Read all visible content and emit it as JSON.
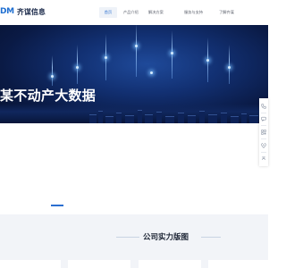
{
  "header": {
    "logo_mark": "DM",
    "logo_name": "齐谋信息",
    "nav": [
      {
        "label": "首页",
        "active": true
      },
      {
        "label": "产品介绍",
        "active": false
      },
      {
        "label": "解决方案",
        "active": false
      },
      {
        "label": "服务与支持",
        "active": false
      },
      {
        "label": "了解齐谋",
        "active": false
      }
    ]
  },
  "hero": {
    "title": "某不动产大数据"
  },
  "sidebar": {
    "buttons": [
      "phone-icon",
      "chat-icon",
      "qrcode-icon",
      "location-icon",
      "back-to-top-icon"
    ]
  },
  "section": {
    "title": "公司实力版图"
  },
  "colors": {
    "accent": "#2b6fd0",
    "hero_dark": "#0a1a45",
    "section_bg": "#f2f4f8"
  }
}
